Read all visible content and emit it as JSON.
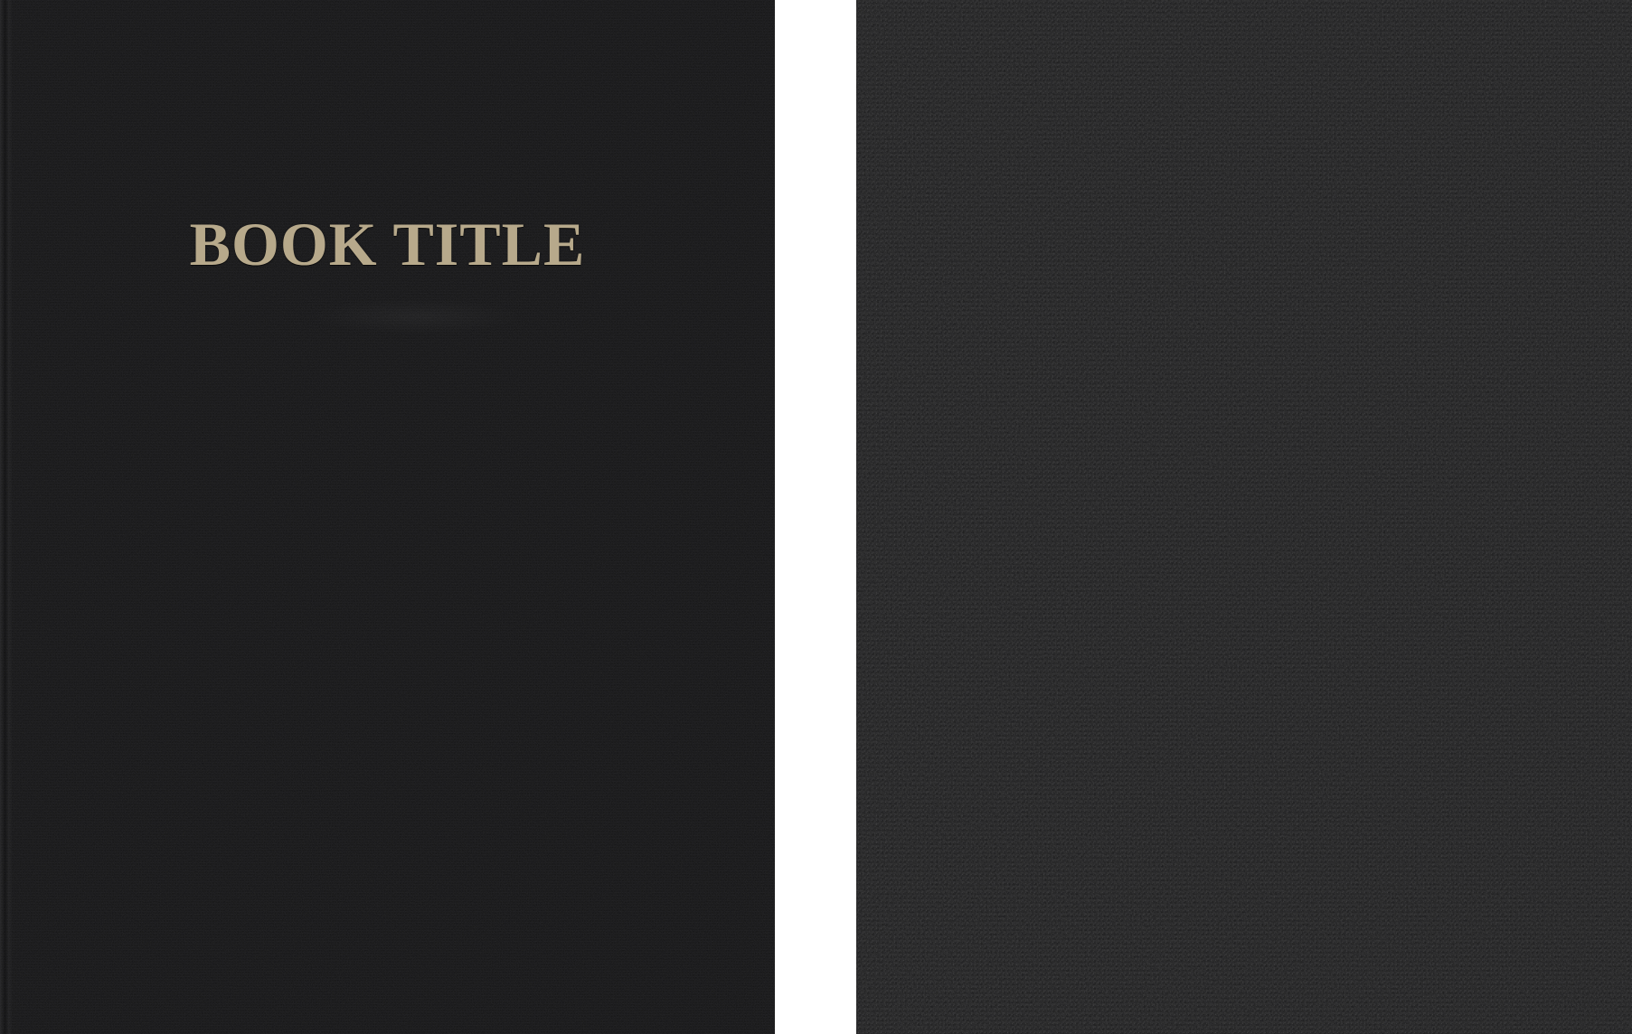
{
  "front_cover": {
    "title": "BOOK TITLE",
    "title_color": "#b7a98b",
    "cloth_color": "#141415"
  },
  "back_cover": {
    "cloth_color": "#1b1b1c"
  },
  "background_color": "#ffffff"
}
